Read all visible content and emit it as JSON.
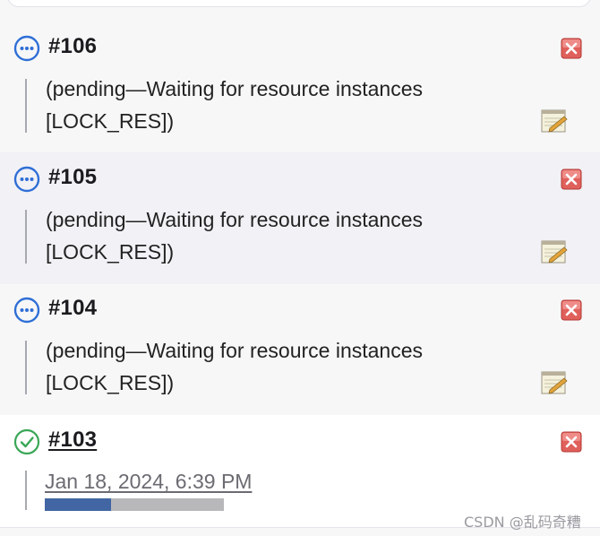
{
  "builds": [
    {
      "number": "#106",
      "status": "pending",
      "status_icon": "pending-dots-icon",
      "description_line1": "(pending—Waiting for resource instances",
      "description_line2": "[LOCK_RES])"
    },
    {
      "number": "#105",
      "status": "pending",
      "status_icon": "pending-dots-icon",
      "description_line1": "(pending—Waiting for resource instances",
      "description_line2": "[LOCK_RES])"
    },
    {
      "number": "#104",
      "status": "pending",
      "status_icon": "pending-dots-icon",
      "description_line1": "(pending—Waiting for resource instances",
      "description_line2": "[LOCK_RES])"
    },
    {
      "number": "#103",
      "status": "success",
      "status_icon": "success-check-icon",
      "timestamp": "Jan 18, 2024, 6:39 PM",
      "progress_fraction": 0.37
    }
  ],
  "colors": {
    "pending_icon": "#2f6fd6",
    "success_icon": "#3aa757",
    "delete_icon": "#d9534f",
    "progress_fill": "#4166a3",
    "progress_track": "#b8b8ba"
  },
  "watermark": "CSDN @乱码奇糟"
}
